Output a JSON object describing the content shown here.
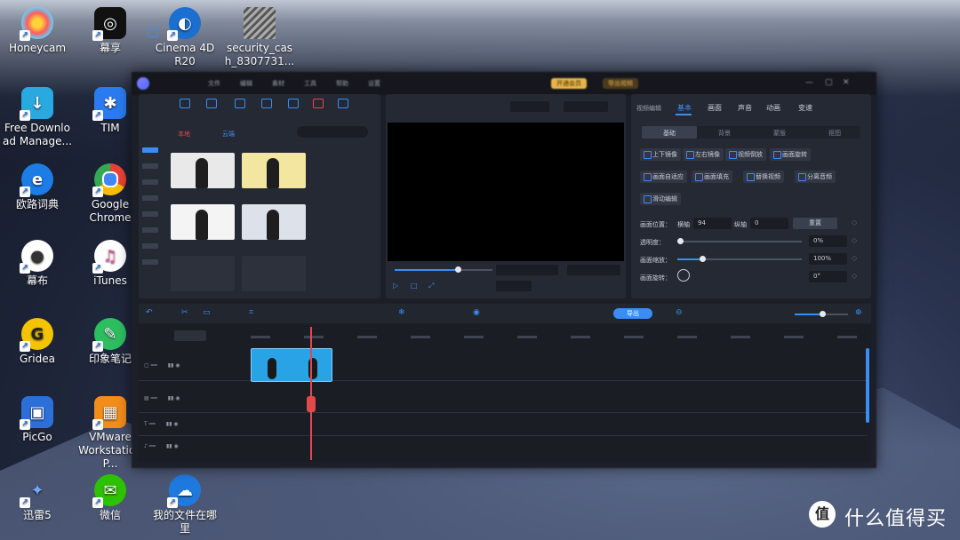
{
  "desktop": {
    "icons": [
      {
        "label": "Honeycam",
        "color": "#f4f4f4"
      },
      {
        "label": "幕享",
        "color": "#111111"
      },
      {
        "label": "Cinema 4D R20",
        "color": "#1a6fd0"
      },
      {
        "label": "security_cas h_8307731...",
        "color": "#6a6a6a"
      },
      {
        "label": "Free Downlo ad Manage...",
        "color": "#2aa8e0"
      },
      {
        "label": "TIM",
        "color": "#2b7bf0"
      },
      {
        "label": "欧路词典",
        "color": "#1c7de6"
      },
      {
        "label": "Google Chrome",
        "color": "#e7b12b"
      },
      {
        "label": "幕布",
        "color": "#ffffff"
      },
      {
        "label": "iTunes",
        "color": "#f25aa0"
      },
      {
        "label": "Gridea",
        "color": "#f5c400"
      },
      {
        "label": "印象笔记",
        "color": "#2dbe60"
      },
      {
        "label": "PicGo",
        "color": "#2c6fd8"
      },
      {
        "label": "VMware Workstation P...",
        "color": "#f28c1b"
      },
      {
        "label": "迅雷5",
        "color": "#2a4f8f"
      },
      {
        "label": "微信",
        "color": "#2dc100"
      },
      {
        "label": "我的文件在哪 里",
        "color": "#1f7ae0"
      }
    ]
  },
  "editor": {
    "menu": [
      "文件",
      "编辑",
      "素材",
      "工具",
      "帮助",
      "设置"
    ],
    "promo_1": "开通会员",
    "promo_2": "导出视频",
    "props": {
      "section_label": "视频编辑",
      "tabs": [
        "基本",
        "画面",
        "声音",
        "动画",
        "变速"
      ],
      "subtabs": [
        "基础",
        "背景",
        "蒙版",
        "抠图"
      ],
      "buttons": [
        "上下镜像",
        "左右镜像",
        "视频倒放",
        "画面旋转",
        "画面自适应",
        "画面填充",
        "替换视频",
        "分离音频",
        "滑动编辑"
      ],
      "position_label": "画面位置：",
      "x_label": "横轴",
      "x_value": "94",
      "y_label": "纵轴",
      "y_value": "0",
      "reset_label": "重置",
      "opacity_label": "透明度：",
      "opacity_value": "0%",
      "opacity_level": 0.0,
      "scale_label": "画面缩放：",
      "scale_value": "100%",
      "scale_level": 0.2,
      "rotate_label": "画面旋转：",
      "rotate_value": "0°"
    },
    "export_label": "导出",
    "media_tabs": [
      "本地",
      "云端"
    ]
  },
  "watermark": {
    "text": "什么值得买",
    "glyph": "值"
  }
}
